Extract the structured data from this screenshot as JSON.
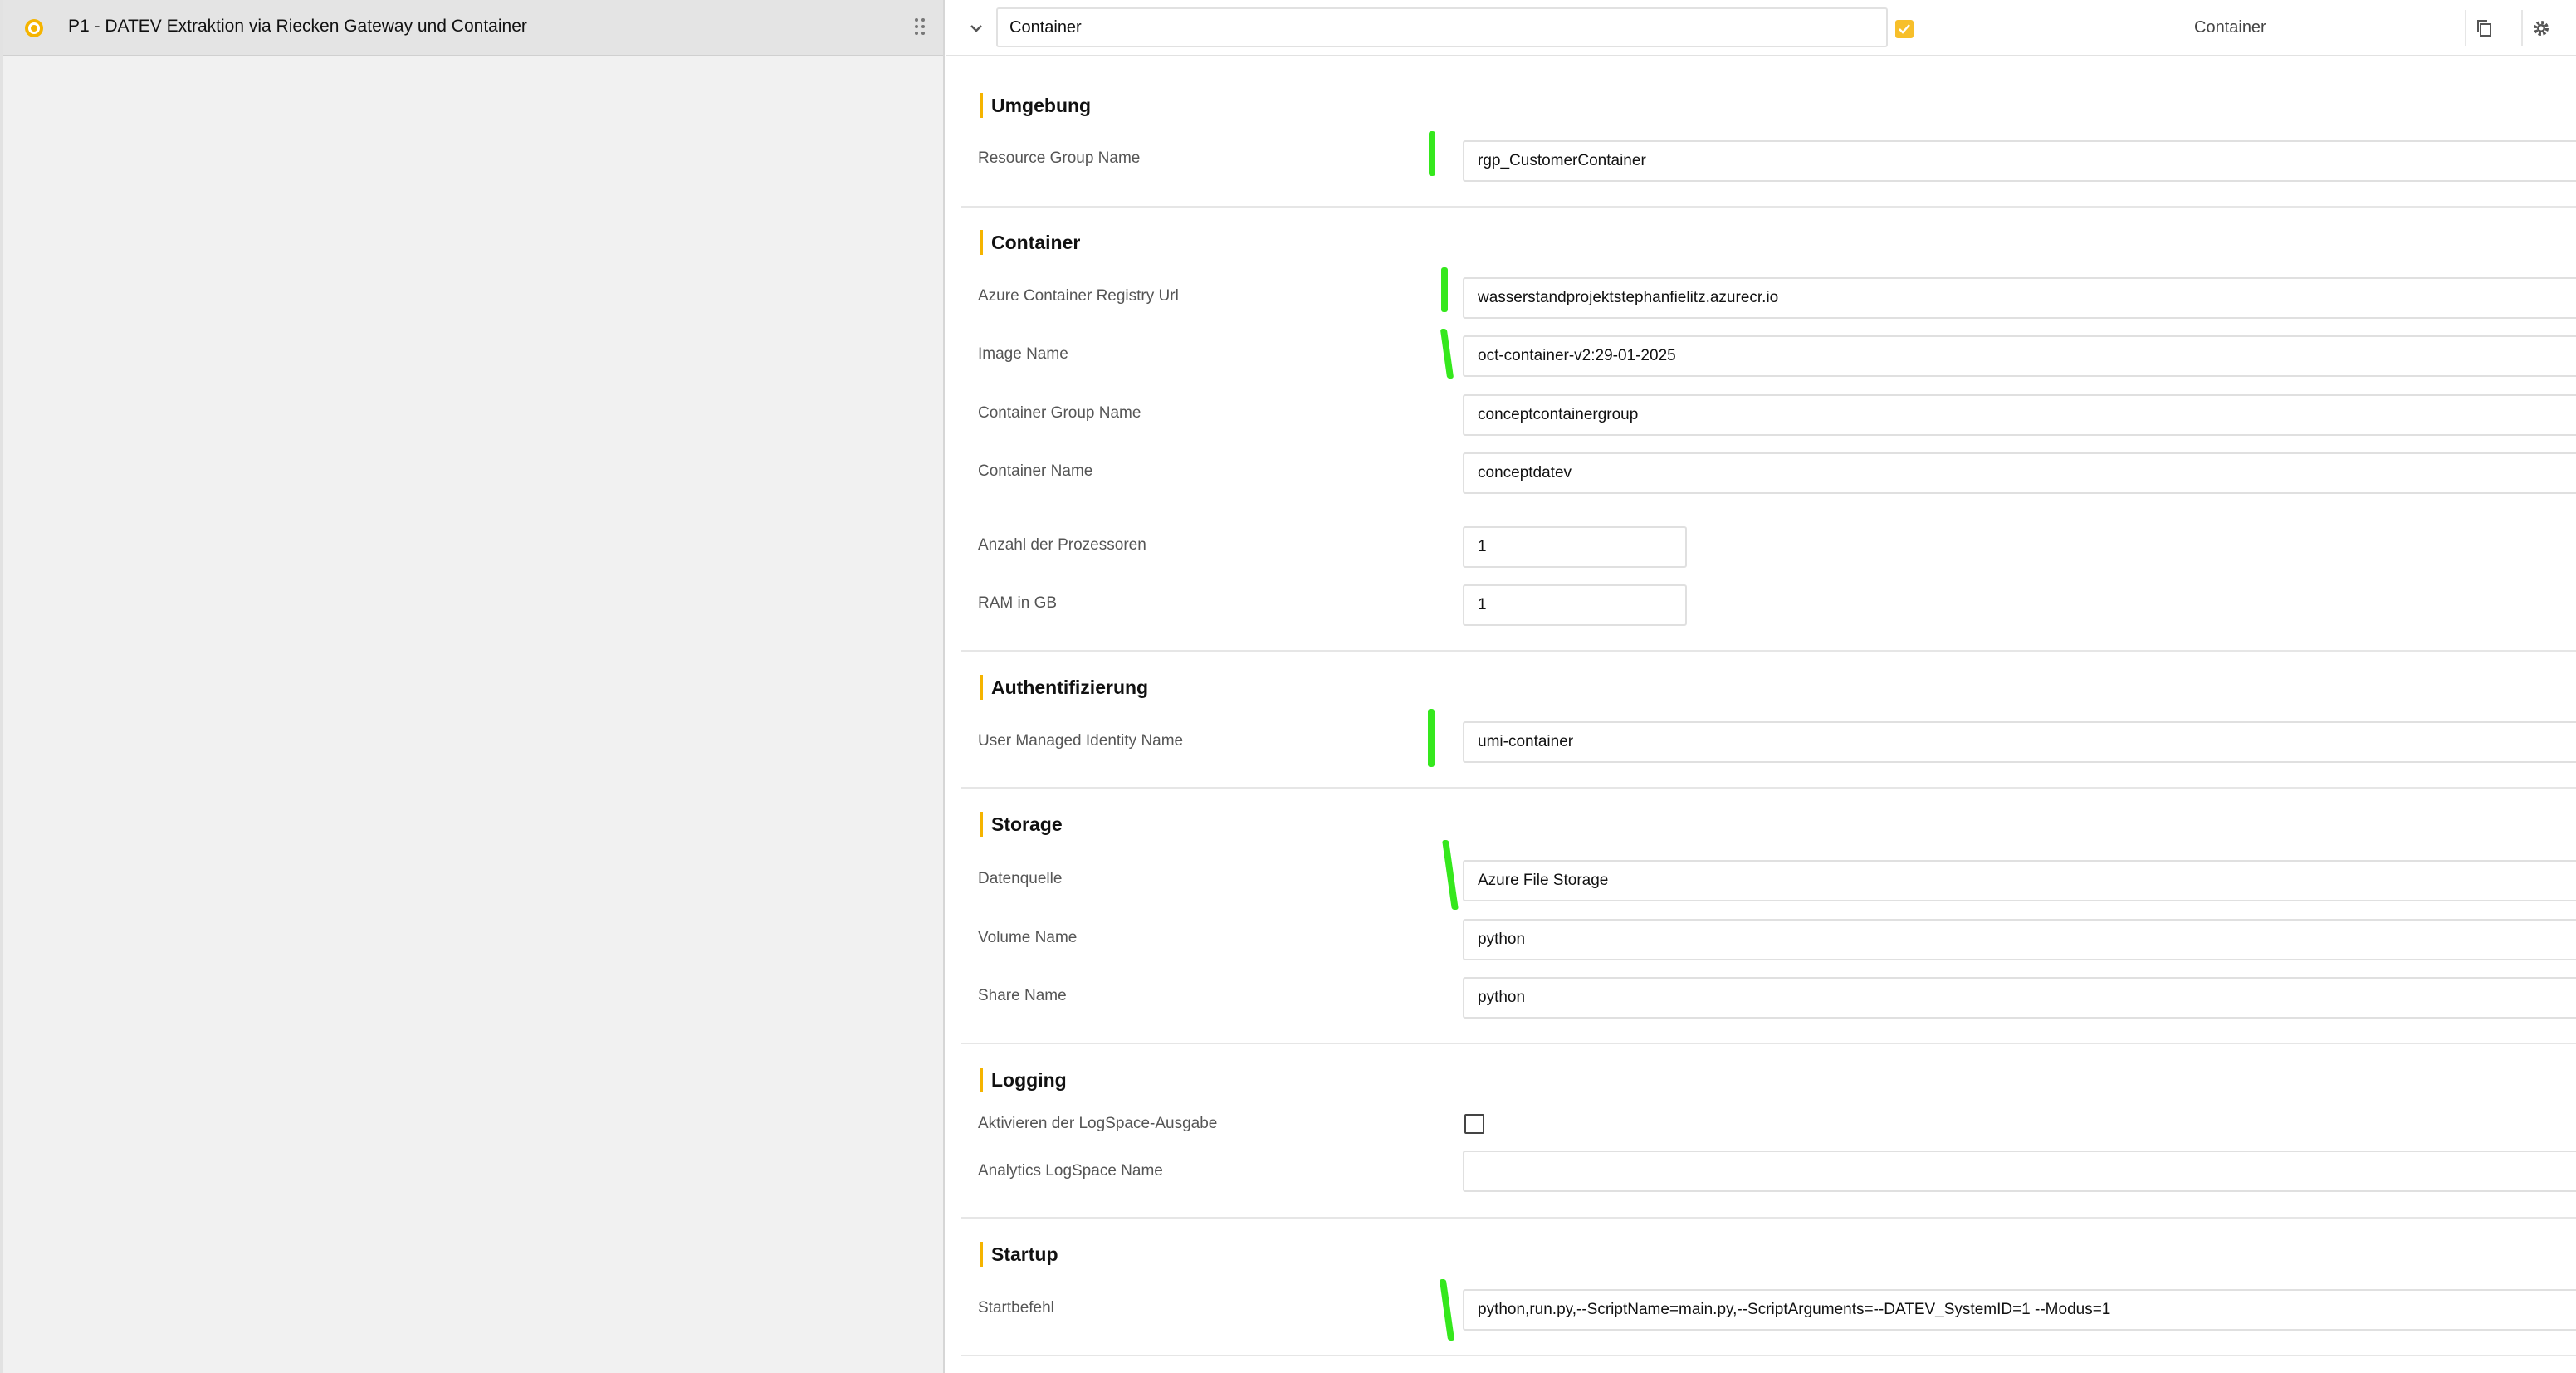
{
  "left": {
    "item_title": "P1 - DATEV Extraktion via Riecken Gateway und Container"
  },
  "header": {
    "name_value": "Container",
    "type_label": "Container"
  },
  "sections": {
    "umgebung": {
      "title": "Umgebung",
      "resource_group_label": "Resource Group Name",
      "resource_group_value": "rgp_CustomerContainer"
    },
    "container": {
      "title": "Container",
      "registry_url_label": "Azure Container Registry Url",
      "registry_url_value": "wasserstandprojektstephanfielitz.azurecr.io",
      "image_name_label": "Image Name",
      "image_name_value": "oct-container-v2:29-01-2025",
      "group_name_label": "Container Group Name",
      "group_name_value": "conceptcontainergroup",
      "container_name_label": "Container Name",
      "container_name_value": "conceptdatev",
      "cpu_label": "Anzahl der Prozessoren",
      "cpu_value": "1",
      "ram_label": "RAM in GB",
      "ram_value": "1"
    },
    "auth": {
      "title": "Authentifizierung",
      "identity_label": "User Managed Identity Name",
      "identity_value": "umi-container"
    },
    "storage": {
      "title": "Storage",
      "source_label": "Datenquelle",
      "source_value": "Azure File Storage",
      "volume_label": "Volume Name",
      "volume_value": "python",
      "share_label": "Share Name",
      "share_value": "python"
    },
    "logging": {
      "title": "Logging",
      "enable_label": "Aktivieren der LogSpace-Ausgabe",
      "enable_checked": false,
      "logspace_label": "Analytics LogSpace Name",
      "logspace_value": ""
    },
    "startup": {
      "title": "Startup",
      "command_label": "Startbefehl",
      "command_value": "python,run.py,--ScriptName=main.py,--ScriptArguments=--DATEV_SystemID=1 --Modus=1"
    }
  },
  "colors": {
    "accent": "#f5b400",
    "marker": "#35e81d"
  },
  "icons": [
    "status-dot-icon",
    "drag-handle-icon",
    "chevron-down-icon",
    "checkbox-checked-icon",
    "copy-icon",
    "gear-icon"
  ]
}
